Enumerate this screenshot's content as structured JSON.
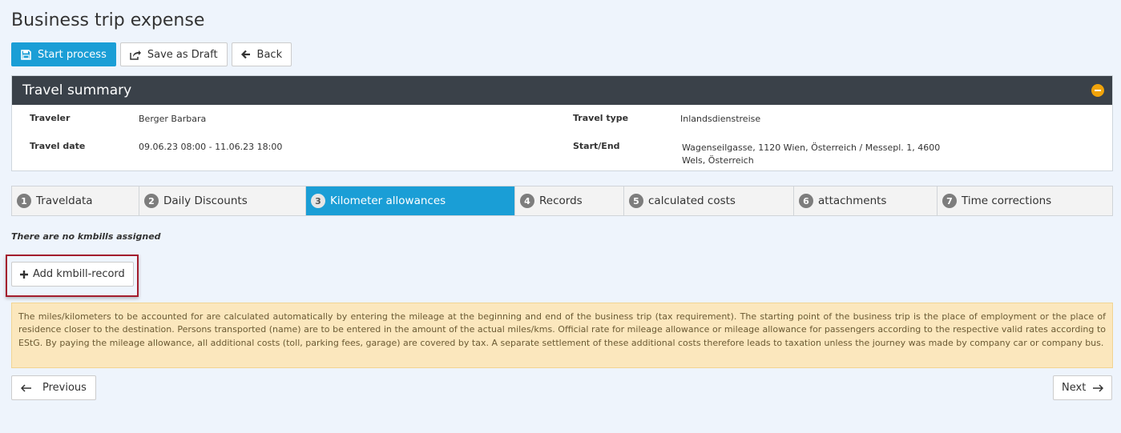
{
  "page": {
    "title": "Business trip expense"
  },
  "toolbar": {
    "start_label": "Start process",
    "draft_label": "Save as Draft",
    "back_label": "Back"
  },
  "summary": {
    "title": "Travel summary",
    "traveler_label": "Traveler",
    "traveler_value": "Berger Barbara",
    "date_label": "Travel date",
    "date_value": "09.06.23 08:00 - 11.06.23 18:00",
    "type_label": "Travel type",
    "type_value": "Inlandsdienstreise",
    "startend_label": "Start/End",
    "startend_line1": "Wagenseilgasse, 1120 Wien, Österreich / Messepl. 1, 4600",
    "startend_line2": "Wels, Österreich"
  },
  "tabs": [
    {
      "num": "1",
      "label": "Traveldata"
    },
    {
      "num": "2",
      "label": "Daily Discounts"
    },
    {
      "num": "3",
      "label": "Kilometer allowances"
    },
    {
      "num": "4",
      "label": "Records"
    },
    {
      "num": "5",
      "label": "calculated costs"
    },
    {
      "num": "6",
      "label": "attachments"
    },
    {
      "num": "7",
      "label": "Time corrections"
    }
  ],
  "active_tab": "3",
  "main": {
    "empty_note": "There are no kmbills assigned",
    "add_label": "Add kmbill-record",
    "info_text": "The miles/kilometers to be accounted for are calculated automatically by entering the mileage at the beginning and end of the business trip (tax requirement). The starting point of the business trip is the place of employment or the place of residence closer to the destination. Persons transported (name) are to be entered in the amount of the actual miles/kms. Official rate for mileage allowance or mileage allowance for passengers according to the respective valid rates according to EStG. By paying the mileage allowance, all additional costs (toll, parking fees, garage) are covered by tax. A separate settlement of these additional costs therefore leads to taxation unless the journey was made by company car or company bus."
  },
  "nav": {
    "prev_label": "Previous",
    "next_label": "Next"
  },
  "colors": {
    "primary": "#1a9ed6",
    "panel_header": "#3a4149",
    "collapse": "#f0a30a",
    "info_bg": "#fbe7bd",
    "highlight": "#a31d2d"
  }
}
